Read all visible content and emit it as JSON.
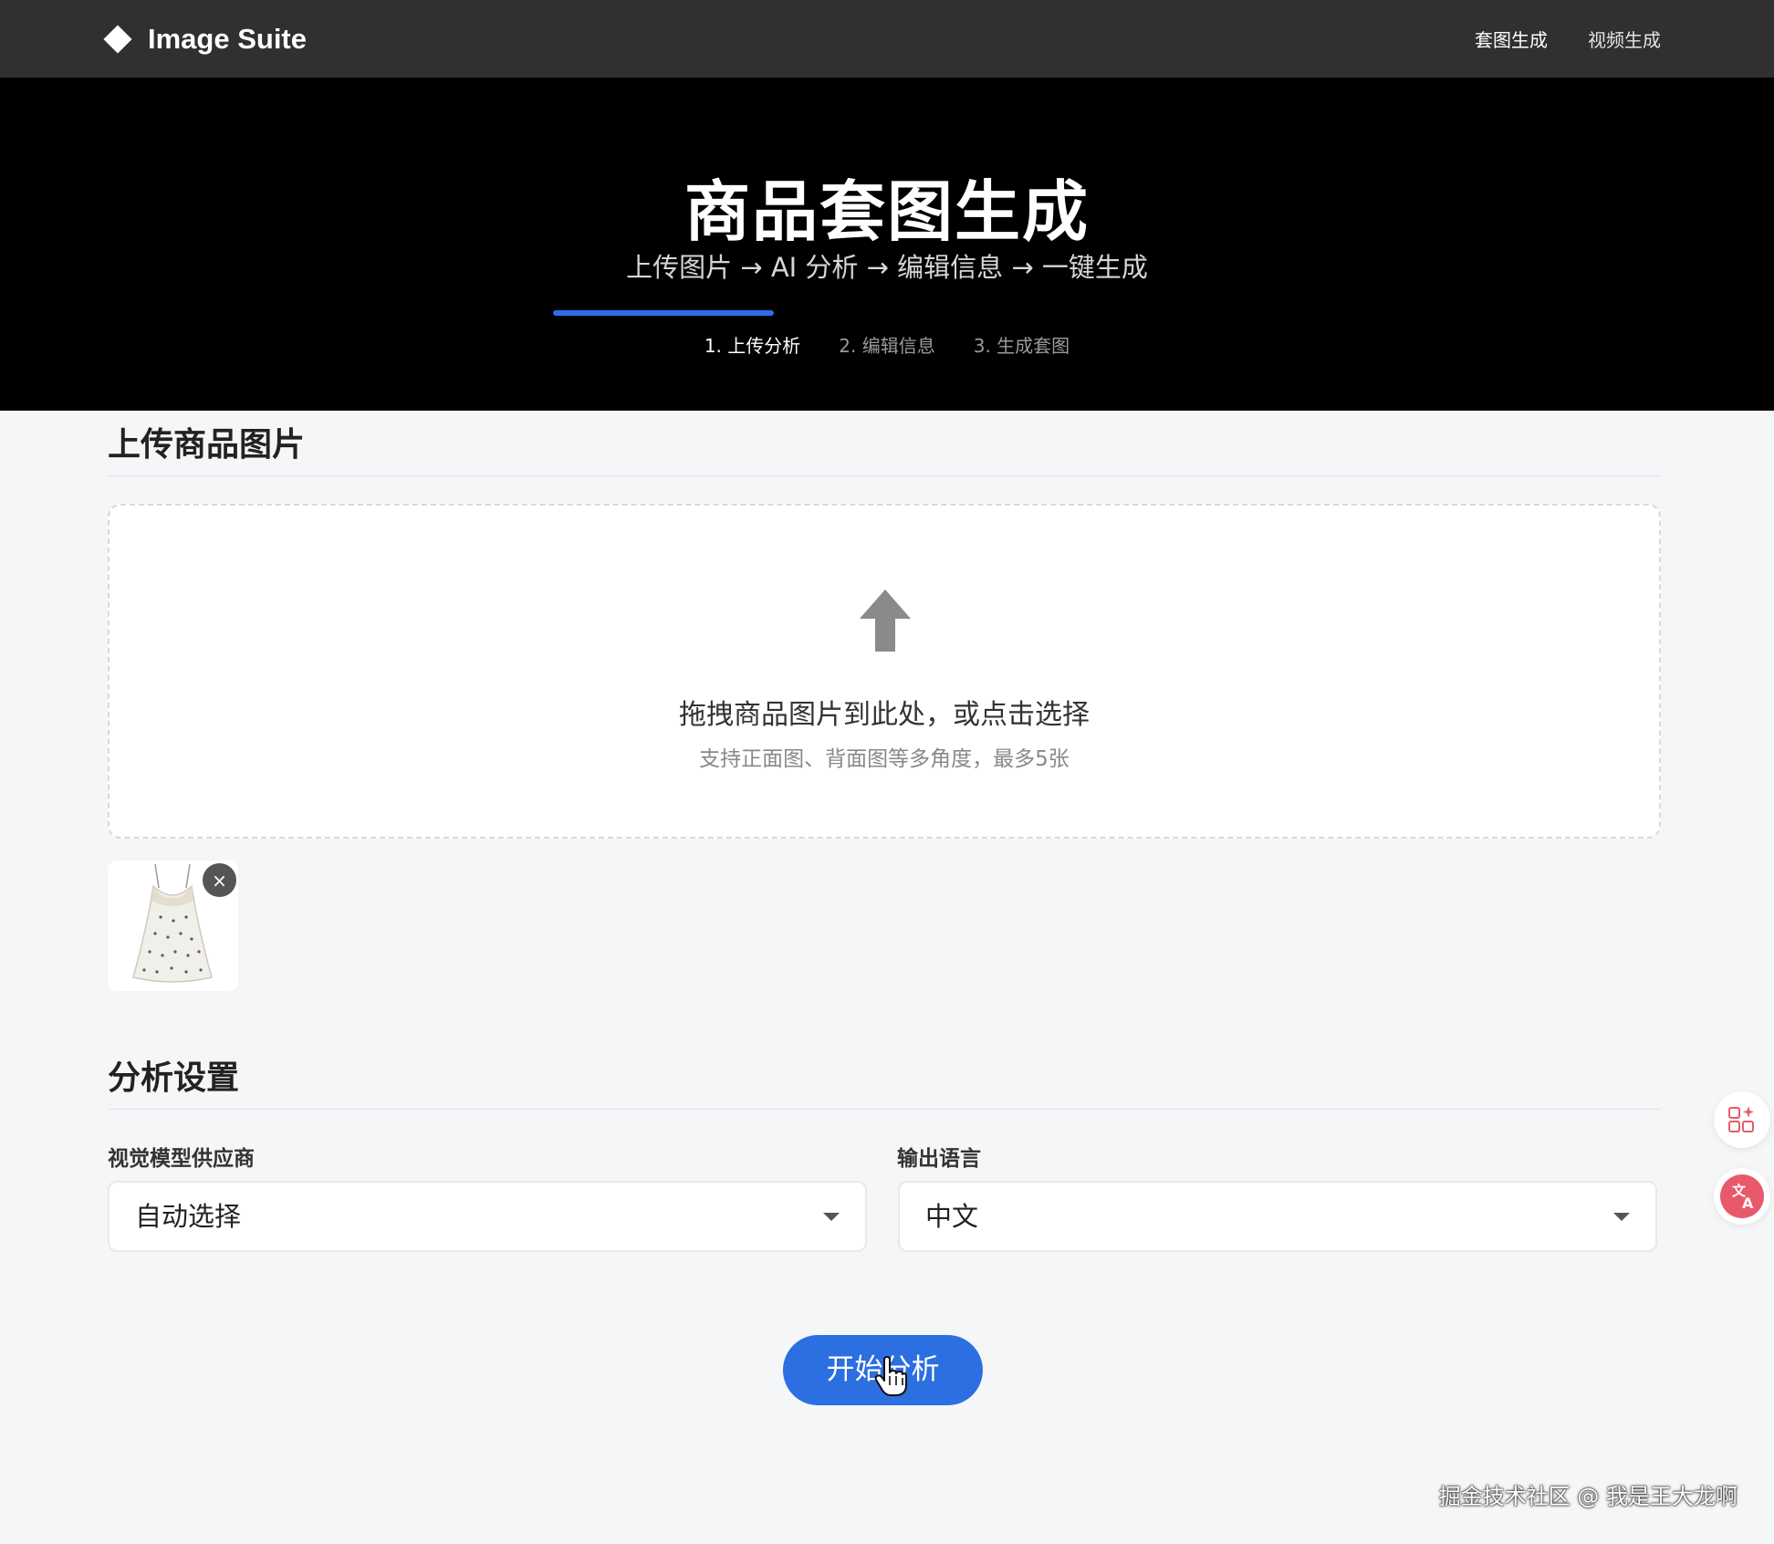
{
  "navbar": {
    "brand_name": "Image Suite",
    "links": [
      "套图生成",
      "视频生成"
    ]
  },
  "hero": {
    "title": "商品套图生成",
    "subtitle": "上传图片 → AI 分析 → 编辑信息 → 一键生成",
    "steps": [
      "1. 上传分析",
      "2. 编辑信息",
      "3. 生成套图"
    ],
    "active_step": 1
  },
  "upload": {
    "section_title": "上传商品图片",
    "drop_main": "拖拽商品图片到此处，或点击选择",
    "drop_hint": "支持正面图、背面图等多角度，最多5张",
    "remove_label": "×"
  },
  "settings": {
    "section_title": "分析设置",
    "provider_label": "视觉模型供应商",
    "provider_value": "自动选择",
    "language_label": "输出语言",
    "language_value": "中文"
  },
  "actions": {
    "start_label": "开始分析"
  },
  "watermark": "掘金技术社区 @ 我是王大龙啊",
  "colors": {
    "accent": "#2b6fe0",
    "navbar": "#303030",
    "hero": "#000000",
    "translate": "#e85a6b"
  }
}
